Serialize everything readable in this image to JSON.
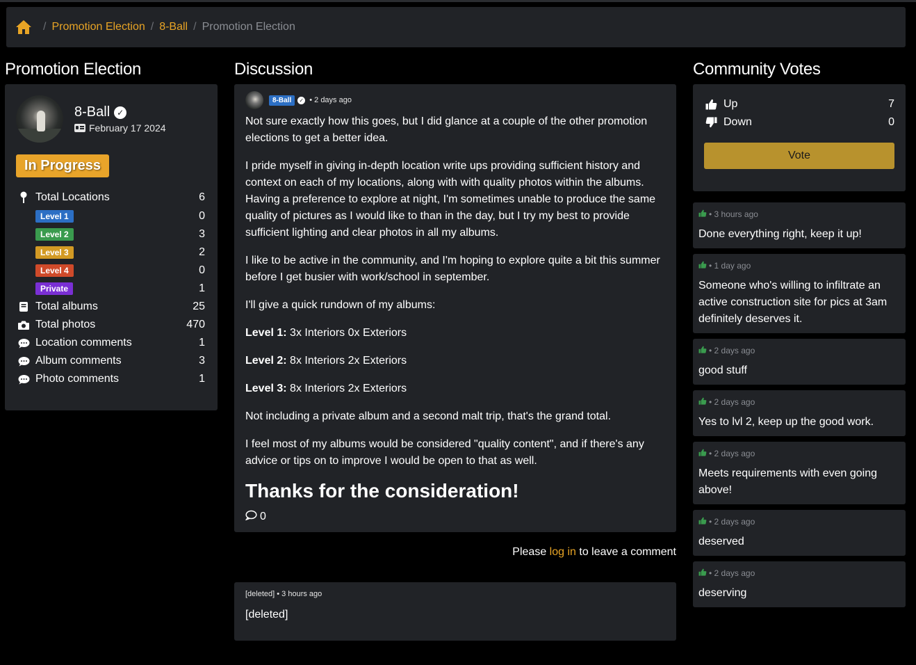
{
  "breadcrumb": {
    "items": [
      "Promotion Election",
      "8-Ball"
    ],
    "current": "Promotion Election"
  },
  "left": {
    "title": "Promotion Election",
    "user": {
      "name": "8-Ball",
      "joined": "February 17 2024"
    },
    "status": "In Progress",
    "stats": {
      "total_locations": {
        "label": "Total Locations",
        "value": "6"
      },
      "level1": {
        "label": "Level 1",
        "value": "0",
        "color": "#2c6fc4"
      },
      "level2": {
        "label": "Level 2",
        "value": "3",
        "color": "#3a9b4e"
      },
      "level3": {
        "label": "Level 3",
        "value": "2",
        "color": "#d39a24"
      },
      "level4": {
        "label": "Level 4",
        "value": "0",
        "color": "#cf4a2a"
      },
      "private": {
        "label": "Private",
        "value": "1",
        "color": "#7a2fd4"
      },
      "total_albums": {
        "label": "Total albums",
        "value": "25"
      },
      "total_photos": {
        "label": "Total photos",
        "value": "470"
      },
      "location_comments": {
        "label": "Location comments",
        "value": "1"
      },
      "album_comments": {
        "label": "Album comments",
        "value": "3"
      },
      "photo_comments": {
        "label": "Photo comments",
        "value": "1"
      }
    }
  },
  "discussion": {
    "title": "Discussion",
    "post": {
      "tag": "8-Ball",
      "time": "• 2 days ago",
      "p1": "Not sure exactly how this goes, but I did glance at a couple of the other promotion elections to get a better idea.",
      "p2": "I pride myself in giving in-depth location write ups providing sufficient history and context on each of my locations, along with with quality photos within the albums. Having a preference to explore at night, I'm sometimes unable to produce the same quality of pictures as I would like to than in the day, but I try my best to provide sufficient lighting and clear photos in all my albums.",
      "p3": "I like to be active in the community, and I'm hoping to explore quite a bit this summer before I get busier with work/school in september.",
      "p4": "I'll give a quick rundown of my albums:",
      "l1_label": "Level 1:",
      "l1_text": " 3x Interiors 0x Exteriors",
      "l2_label": "Level 2:",
      "l2_text": " 8x Interiors 2x Exteriors",
      "l3_label": "Level 3:",
      "l3_text": " 8x Interiors 2x Exteriors",
      "p5": "Not including a private album and a second malt trip, that's the grand total.",
      "p6": "I feel most of my albums would be considered \"quality content\", and if there's any advice or tips on to improve I would be open to that as well.",
      "heading": "Thanks for the consideration!",
      "comments": "0"
    },
    "login": {
      "before": "Please ",
      "link": "log in",
      "after": " to leave a comment"
    },
    "comment": {
      "author": "[deleted]",
      "time": " • 3 hours ago",
      "text": "[deleted]"
    }
  },
  "votes": {
    "title": "Community Votes",
    "up_label": "Up",
    "up_value": "7",
    "down_label": "Down",
    "down_value": "0",
    "button": "Vote",
    "cards": [
      {
        "time": "• 3 hours ago",
        "text": "Done everything right, keep it up!"
      },
      {
        "time": "• 1 day ago",
        "text": "Someone who's willing to infiltrate an active construction site for pics at 3am definitely deserves it."
      },
      {
        "time": "• 2 days ago",
        "text": "good stuff"
      },
      {
        "time": "• 2 days ago",
        "text": "Yes to lvl 2, keep up the good work."
      },
      {
        "time": "• 2 days ago",
        "text": "Meets requirements with even going above!"
      },
      {
        "time": "• 2 days ago",
        "text": "deserved"
      },
      {
        "time": "• 2 days ago",
        "text": "deserving"
      }
    ]
  },
  "colors": {
    "accent": "#e8a425",
    "panel": "#212327",
    "vote_button": "#b8922d",
    "thumb": "#3a9b4e"
  }
}
